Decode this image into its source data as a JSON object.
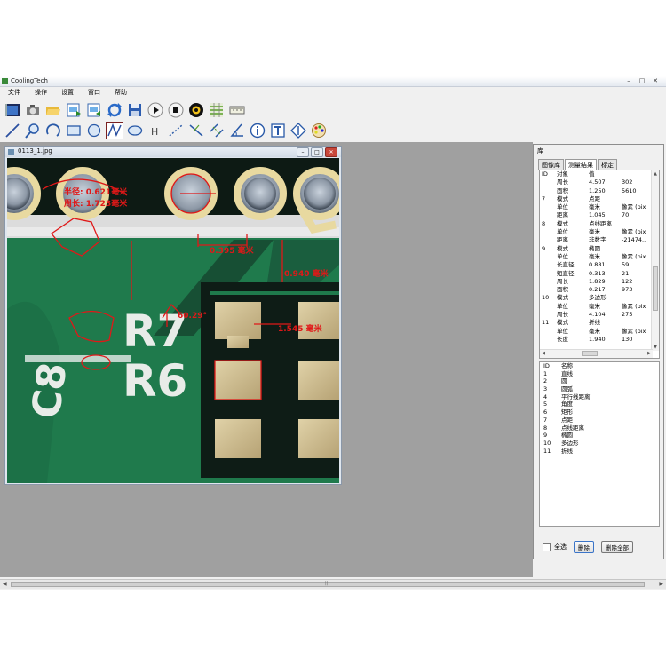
{
  "window": {
    "title": "CoolingTech",
    "buttons": [
      "–",
      "□",
      "✕"
    ]
  },
  "menu": [
    "文件",
    "操作",
    "设置",
    "窗口",
    "帮助"
  ],
  "toolbar1": [
    "video-icon",
    "camera-icon",
    "folder-open-icon",
    "image-export-icon",
    "image-import-icon",
    "refresh-icon",
    "save-icon",
    "play-icon",
    "stop-icon",
    "settings-icon",
    "grid-icon",
    "ruler-icon"
  ],
  "toolbar2": [
    "line-icon",
    "zoom-icon",
    "arc-icon",
    "rectangle-icon",
    "circle-icon",
    "polyline-icon",
    "ellipse-icon",
    "h-measure-icon",
    "dotted-line-icon",
    "perpendicular-icon",
    "parallel-icon",
    "angle-icon",
    "info-icon",
    "text-icon",
    "vertical-measure-icon",
    "palette-icon"
  ],
  "image_window": {
    "title": "0113_1.jpg",
    "controls": [
      "–",
      "□",
      "✕"
    ],
    "annotations": {
      "radius": "半径: 0.621毫米",
      "perimeter": "周长: 1.723毫米",
      "dist1": "0.395 毫米",
      "dist2": "0.940 毫米",
      "angle": "60.29°",
      "dist3": "1.545 毫米",
      "silk1": "R7",
      "silk2": "R6",
      "silk3": "C8"
    }
  },
  "library": {
    "title": "库",
    "tabs": [
      "图像库",
      "测量结果",
      "标定"
    ],
    "active_tab": "测量结果",
    "results_header": [
      "ID",
      "对象",
      "值",
      ""
    ],
    "results_rows": [
      [
        "",
        "周长",
        "4.507",
        "302"
      ],
      [
        "",
        "面积",
        "1.250",
        "5610"
      ],
      [
        "7",
        "模式",
        "点距",
        ""
      ],
      [
        "",
        "单位",
        "毫米",
        "像素 (pix"
      ],
      [
        "",
        "距离",
        "1.045",
        "70"
      ],
      [
        "8",
        "模式",
        "点线距离",
        ""
      ],
      [
        "",
        "单位",
        "毫米",
        "像素 (pix"
      ],
      [
        "",
        "距离",
        "非数字",
        "-21474.."
      ],
      [
        "9",
        "模式",
        "椭圆",
        ""
      ],
      [
        "",
        "单位",
        "毫米",
        "像素 (pix"
      ],
      [
        "",
        "长直径",
        "0.881",
        "59"
      ],
      [
        "",
        "短直径",
        "0.313",
        "21"
      ],
      [
        "",
        "周长",
        "1.829",
        "122"
      ],
      [
        "",
        "面积",
        "0.217",
        "973"
      ],
      [
        "10",
        "模式",
        "多边形",
        ""
      ],
      [
        "",
        "单位",
        "毫米",
        "像素 (pix"
      ],
      [
        "",
        "周长",
        "4.104",
        "275"
      ],
      [
        "11",
        "模式",
        "折线",
        ""
      ],
      [
        "",
        "单位",
        "毫米",
        "像素 (pix"
      ],
      [
        "",
        "长度",
        "1.940",
        "130"
      ]
    ],
    "objects_header": [
      "ID",
      "名称"
    ],
    "objects": [
      [
        "1",
        "直线"
      ],
      [
        "2",
        "圆"
      ],
      [
        "3",
        "圆弧"
      ],
      [
        "4",
        "平行线距离"
      ],
      [
        "5",
        "角度"
      ],
      [
        "6",
        "矩形"
      ],
      [
        "7",
        "点距"
      ],
      [
        "8",
        "点线距离"
      ],
      [
        "9",
        "椭圆"
      ],
      [
        "10",
        "多边形"
      ],
      [
        "11",
        "折线"
      ]
    ],
    "select_all": "全选",
    "delete": "删除",
    "delete_all": "删除全部"
  },
  "colors": {
    "annotation": "#e01818",
    "pcb": "#1f7a4c"
  }
}
